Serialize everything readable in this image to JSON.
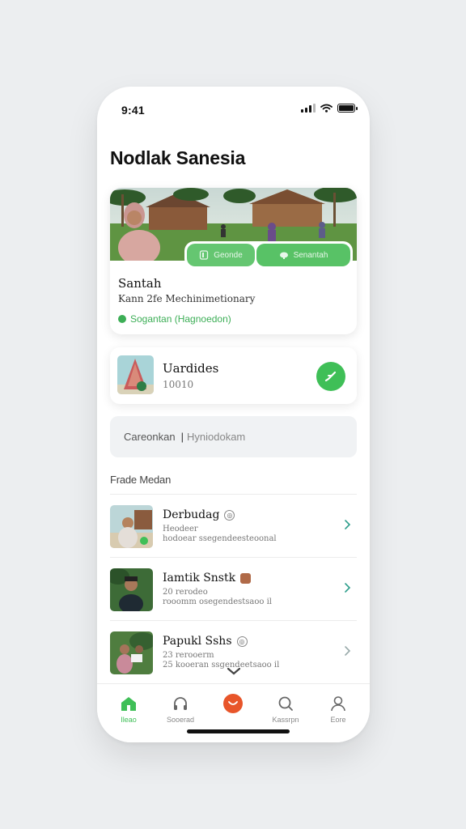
{
  "status_bar": {
    "time": "9:41"
  },
  "header": {
    "title": "Nodlak Sanesia"
  },
  "featured": {
    "button_a": "Geonde",
    "button_b": "Senantah",
    "name": "Santah",
    "subtitle": "Kann 2fe Mechinimetionary",
    "tag": "Sogantan (Hagnoedon)"
  },
  "info_card": {
    "title": "Uardides",
    "subtitle": "10010"
  },
  "search": {
    "value": "Careonkan",
    "placeholder": "Hyniodokam"
  },
  "section_label": "Frade Medan",
  "list": [
    {
      "name": "Derbudag",
      "line1": "Heodeer",
      "line2": "hodoear ssegendeesteoonal",
      "badge": "sync-icon"
    },
    {
      "name": "Iamtik Snstk",
      "line1": "20 rerodeo",
      "line2": "rooomm osegendestsaoo il",
      "badge": "food-icon"
    },
    {
      "name": "Papukl Sshs",
      "line1": "23 rerooerm",
      "line2": "25 kooeran ssgendeetsaoo il",
      "badge": "sync-icon"
    }
  ],
  "tabbar": [
    {
      "label": "Ileao",
      "icon": "home-icon",
      "active": true
    },
    {
      "label": "Sooerad",
      "icon": "headphones-icon",
      "active": false
    },
    {
      "label": "",
      "icon": "add-icon",
      "active": false
    },
    {
      "label": "Kassrpn",
      "icon": "chat-search-icon",
      "active": false
    },
    {
      "label": "Eore",
      "icon": "profile-icon",
      "active": false
    }
  ],
  "colors": {
    "accent": "#3fbf57",
    "center": "#e8552a",
    "background": "#eceef0"
  }
}
